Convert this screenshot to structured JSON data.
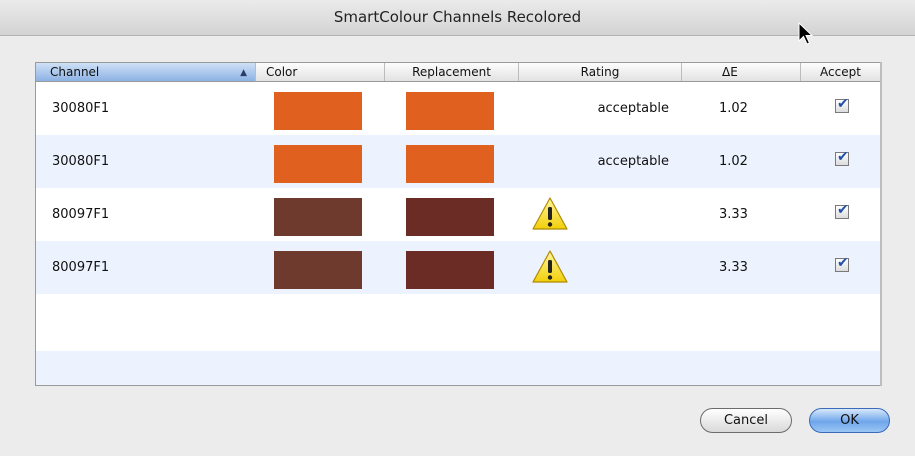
{
  "window": {
    "title": "SmartColour Channels Recolored"
  },
  "table": {
    "columns": [
      "Channel",
      "Color",
      "Replacement",
      "Rating",
      "ΔE",
      "Accept"
    ],
    "sorted_column": "Channel",
    "rows": [
      {
        "channel": "30080F1",
        "color": "#e06020",
        "replacement": "#e06020",
        "rating": "acceptable",
        "warning": false,
        "delta": "1.02",
        "accept": true
      },
      {
        "channel": "30080F1",
        "color": "#e06020",
        "replacement": "#e06020",
        "rating": "acceptable",
        "warning": false,
        "delta": "1.02",
        "accept": true
      },
      {
        "channel": "80097F1",
        "color": "#6e3a2e",
        "replacement": "#6b2c26",
        "rating": "",
        "warning": true,
        "delta": "3.33",
        "accept": true
      },
      {
        "channel": "80097F1",
        "color": "#6e3a2e",
        "replacement": "#6b2c26",
        "rating": "",
        "warning": true,
        "delta": "3.33",
        "accept": true
      }
    ]
  },
  "buttons": {
    "cancel": "Cancel",
    "ok": "OK"
  },
  "colors": {
    "row_alt": "#edf3fe",
    "header_sorted": "#8db2e5",
    "checkbox_tick": "#1f4fa8"
  },
  "icons": {
    "warning": "warning-triangle-icon",
    "sort": "sort-ascending-icon",
    "cursor": "mouse-pointer-icon"
  }
}
